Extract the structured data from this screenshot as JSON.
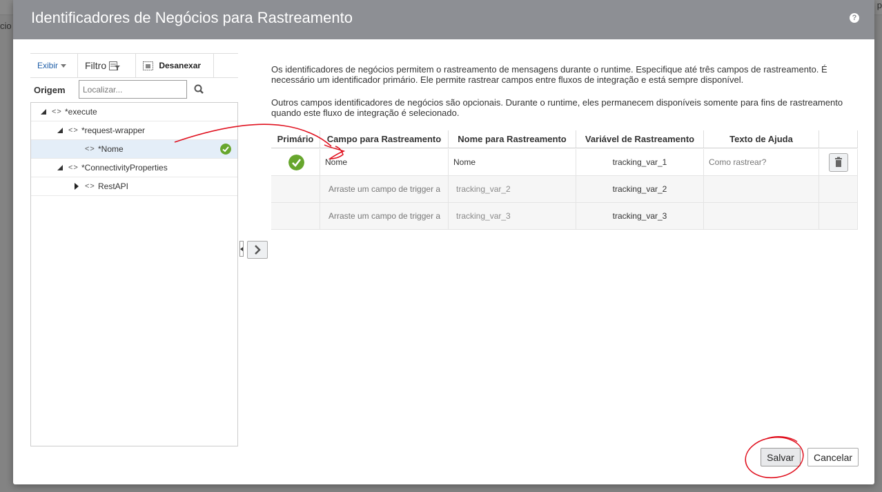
{
  "background": {
    "left_text": "cio",
    "right_text": "p"
  },
  "dialog": {
    "title": "Identificadores de Negócios para Rastreamento",
    "help_icon": "question-icon"
  },
  "toolbar": {
    "exibir_label": "Exibir",
    "filtro_label": "Filtro",
    "desanexar_label": "Desanexar"
  },
  "source": {
    "origem_label": "Origem",
    "search_placeholder": "Localizar..."
  },
  "tree": {
    "nodes": [
      {
        "label": "*execute",
        "expanded": true
      },
      {
        "label": "*request-wrapper",
        "expanded": true
      },
      {
        "label": "*Nome",
        "selected": true,
        "status_icon": "check-circle-icon"
      },
      {
        "label": "*ConnectivityProperties",
        "expanded": true
      },
      {
        "label": "RestAPI",
        "expanded": false
      }
    ]
  },
  "description": {
    "paragraph1": "Os identificadores de negócios permitem o rastreamento de mensagens durante o runtime. Especifique até três campos de rastreamento. É necessário um identificador primário. Ele permite rastrear campos entre fluxos de integração e está sempre disponível.",
    "paragraph2": "Outros campos identificadores de negócios são opcionais. Durante o runtime, eles permanecem disponíveis somente para fins de rastreamento quando este fluxo de integração é selecionado."
  },
  "table": {
    "columns": [
      "Primário",
      "Campo para Rastreamento",
      "Nome para Rastreamento",
      "Variável de Rastreamento",
      "Texto de Ajuda"
    ],
    "rows": [
      {
        "primary": true,
        "field": "Nome",
        "name": "Nome",
        "variable": "tracking_var_1",
        "help": "Como rastrear?",
        "delete_icon": "trash-icon"
      },
      {
        "primary": false,
        "field": "Arraste um campo de trigger a",
        "name": "tracking_var_2",
        "variable": "tracking_var_2",
        "help": ""
      },
      {
        "primary": false,
        "field": "Arraste um campo de trigger a",
        "name": "tracking_var_3",
        "variable": "tracking_var_3",
        "help": ""
      }
    ]
  },
  "footer": {
    "save_label": "Salvar",
    "cancel_label": "Cancelar"
  },
  "colors": {
    "header_bg": "#8d8f94",
    "check_green": "#67a62d",
    "link_blue": "#1f5fa8",
    "annotation_red": "#e0101e"
  }
}
